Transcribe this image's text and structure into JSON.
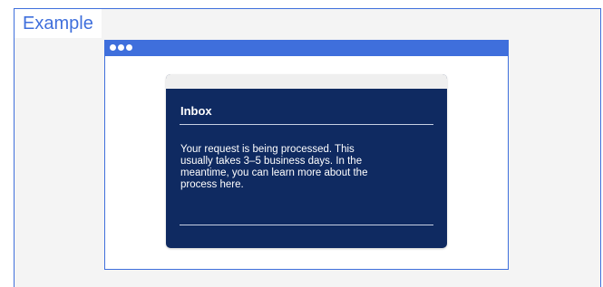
{
  "example": {
    "label": "Example"
  },
  "card": {
    "title": "Inbox",
    "message": "Your request is being processed. This usually takes 3–5 business days. In the meantime, you can learn more about the process here."
  },
  "colors": {
    "accent": "#3f6fdc",
    "card_background": "#0f2a61",
    "frame_background": "#f4f4f4"
  }
}
